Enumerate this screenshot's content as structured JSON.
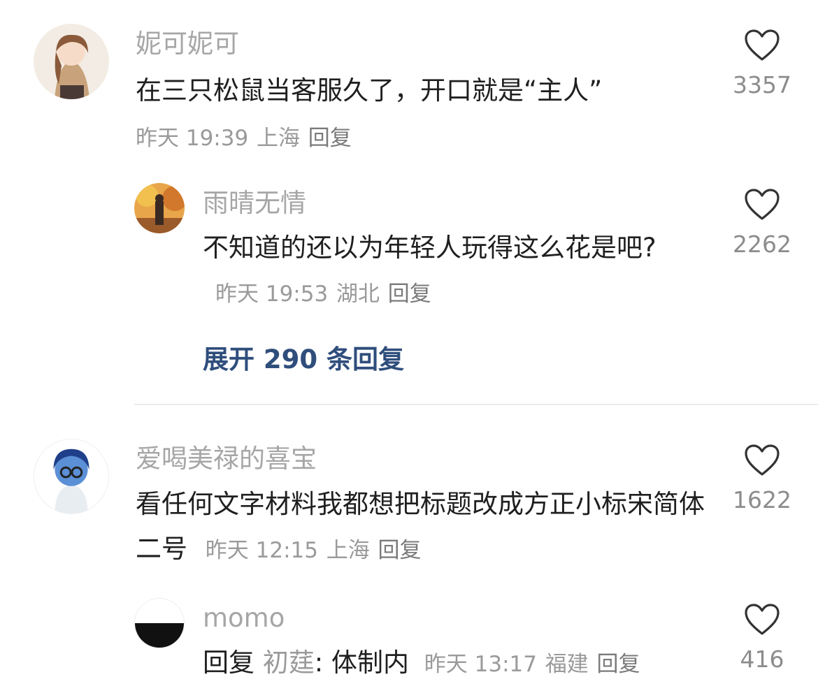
{
  "comments": [
    {
      "name": "妮可妮可",
      "text": "在三只松鼠当客服久了，开口就是“主人”",
      "time": "昨天 19:39",
      "location": "上海",
      "reply": "回复",
      "likes": "3357",
      "avatar_icon": "anime-girl-avatar",
      "replies": [
        {
          "name": "雨晴无情",
          "text": "不知道的还以为年轻人玩得这么花是吧?",
          "time": "昨天 19:53",
          "location": "湖北",
          "reply": "回复",
          "likes": "2262",
          "avatar_icon": "autumn-painting-avatar"
        }
      ],
      "expand_label": "展开 290 条回复"
    },
    {
      "name": "爱喝美禄的喜宝",
      "text": "看任何文字材料我都想把标题改成方正小标宋简体二号",
      "time": "昨天 12:15",
      "location": "上海",
      "reply": "回复",
      "likes": "1622",
      "avatar_icon": "sadness-character-avatar",
      "replies": [
        {
          "name": "momo",
          "reply_prefix": "回复",
          "reply_to": "初莛",
          "text": ": 体制内",
          "time": "昨天 13:17",
          "location": "福建",
          "reply": "回复",
          "likes": "416",
          "avatar_icon": "black-white-avatar"
        }
      ]
    }
  ],
  "colors": {
    "accent_link": "#2f4e7c",
    "muted": "#9a9a9a",
    "divider": "#ececec"
  }
}
